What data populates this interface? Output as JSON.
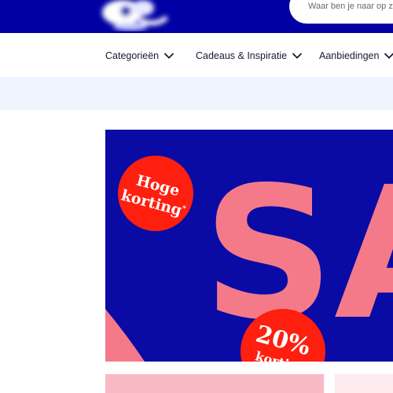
{
  "header": {
    "brand_color": "#0000a4",
    "logo_icon": "blurred-logo-icon",
    "search_placeholder": "Waar ben je naar op zoek?"
  },
  "nav": {
    "items": [
      {
        "label": "Categorieën",
        "icon": "chevron-down-icon"
      },
      {
        "label": "Cadeaus & Inspiratie",
        "icon": "chevron-down-icon"
      },
      {
        "label": "Aanbiedingen",
        "icon": "chevron-down-icon"
      }
    ]
  },
  "hero": {
    "background_color": "#0a0aa5",
    "headline": "SA",
    "headline_color": "#f47a8a",
    "badge_color": "#ff1f0f",
    "badge1": {
      "line1": "Hoge",
      "line2": "korting",
      "mark": "*"
    },
    "badge2": {
      "percent": "20%",
      "line2": "korting",
      "mark": "*"
    }
  },
  "cards": {
    "card1_color": "#f8b9c4",
    "card2_color": "#fdeaee"
  }
}
